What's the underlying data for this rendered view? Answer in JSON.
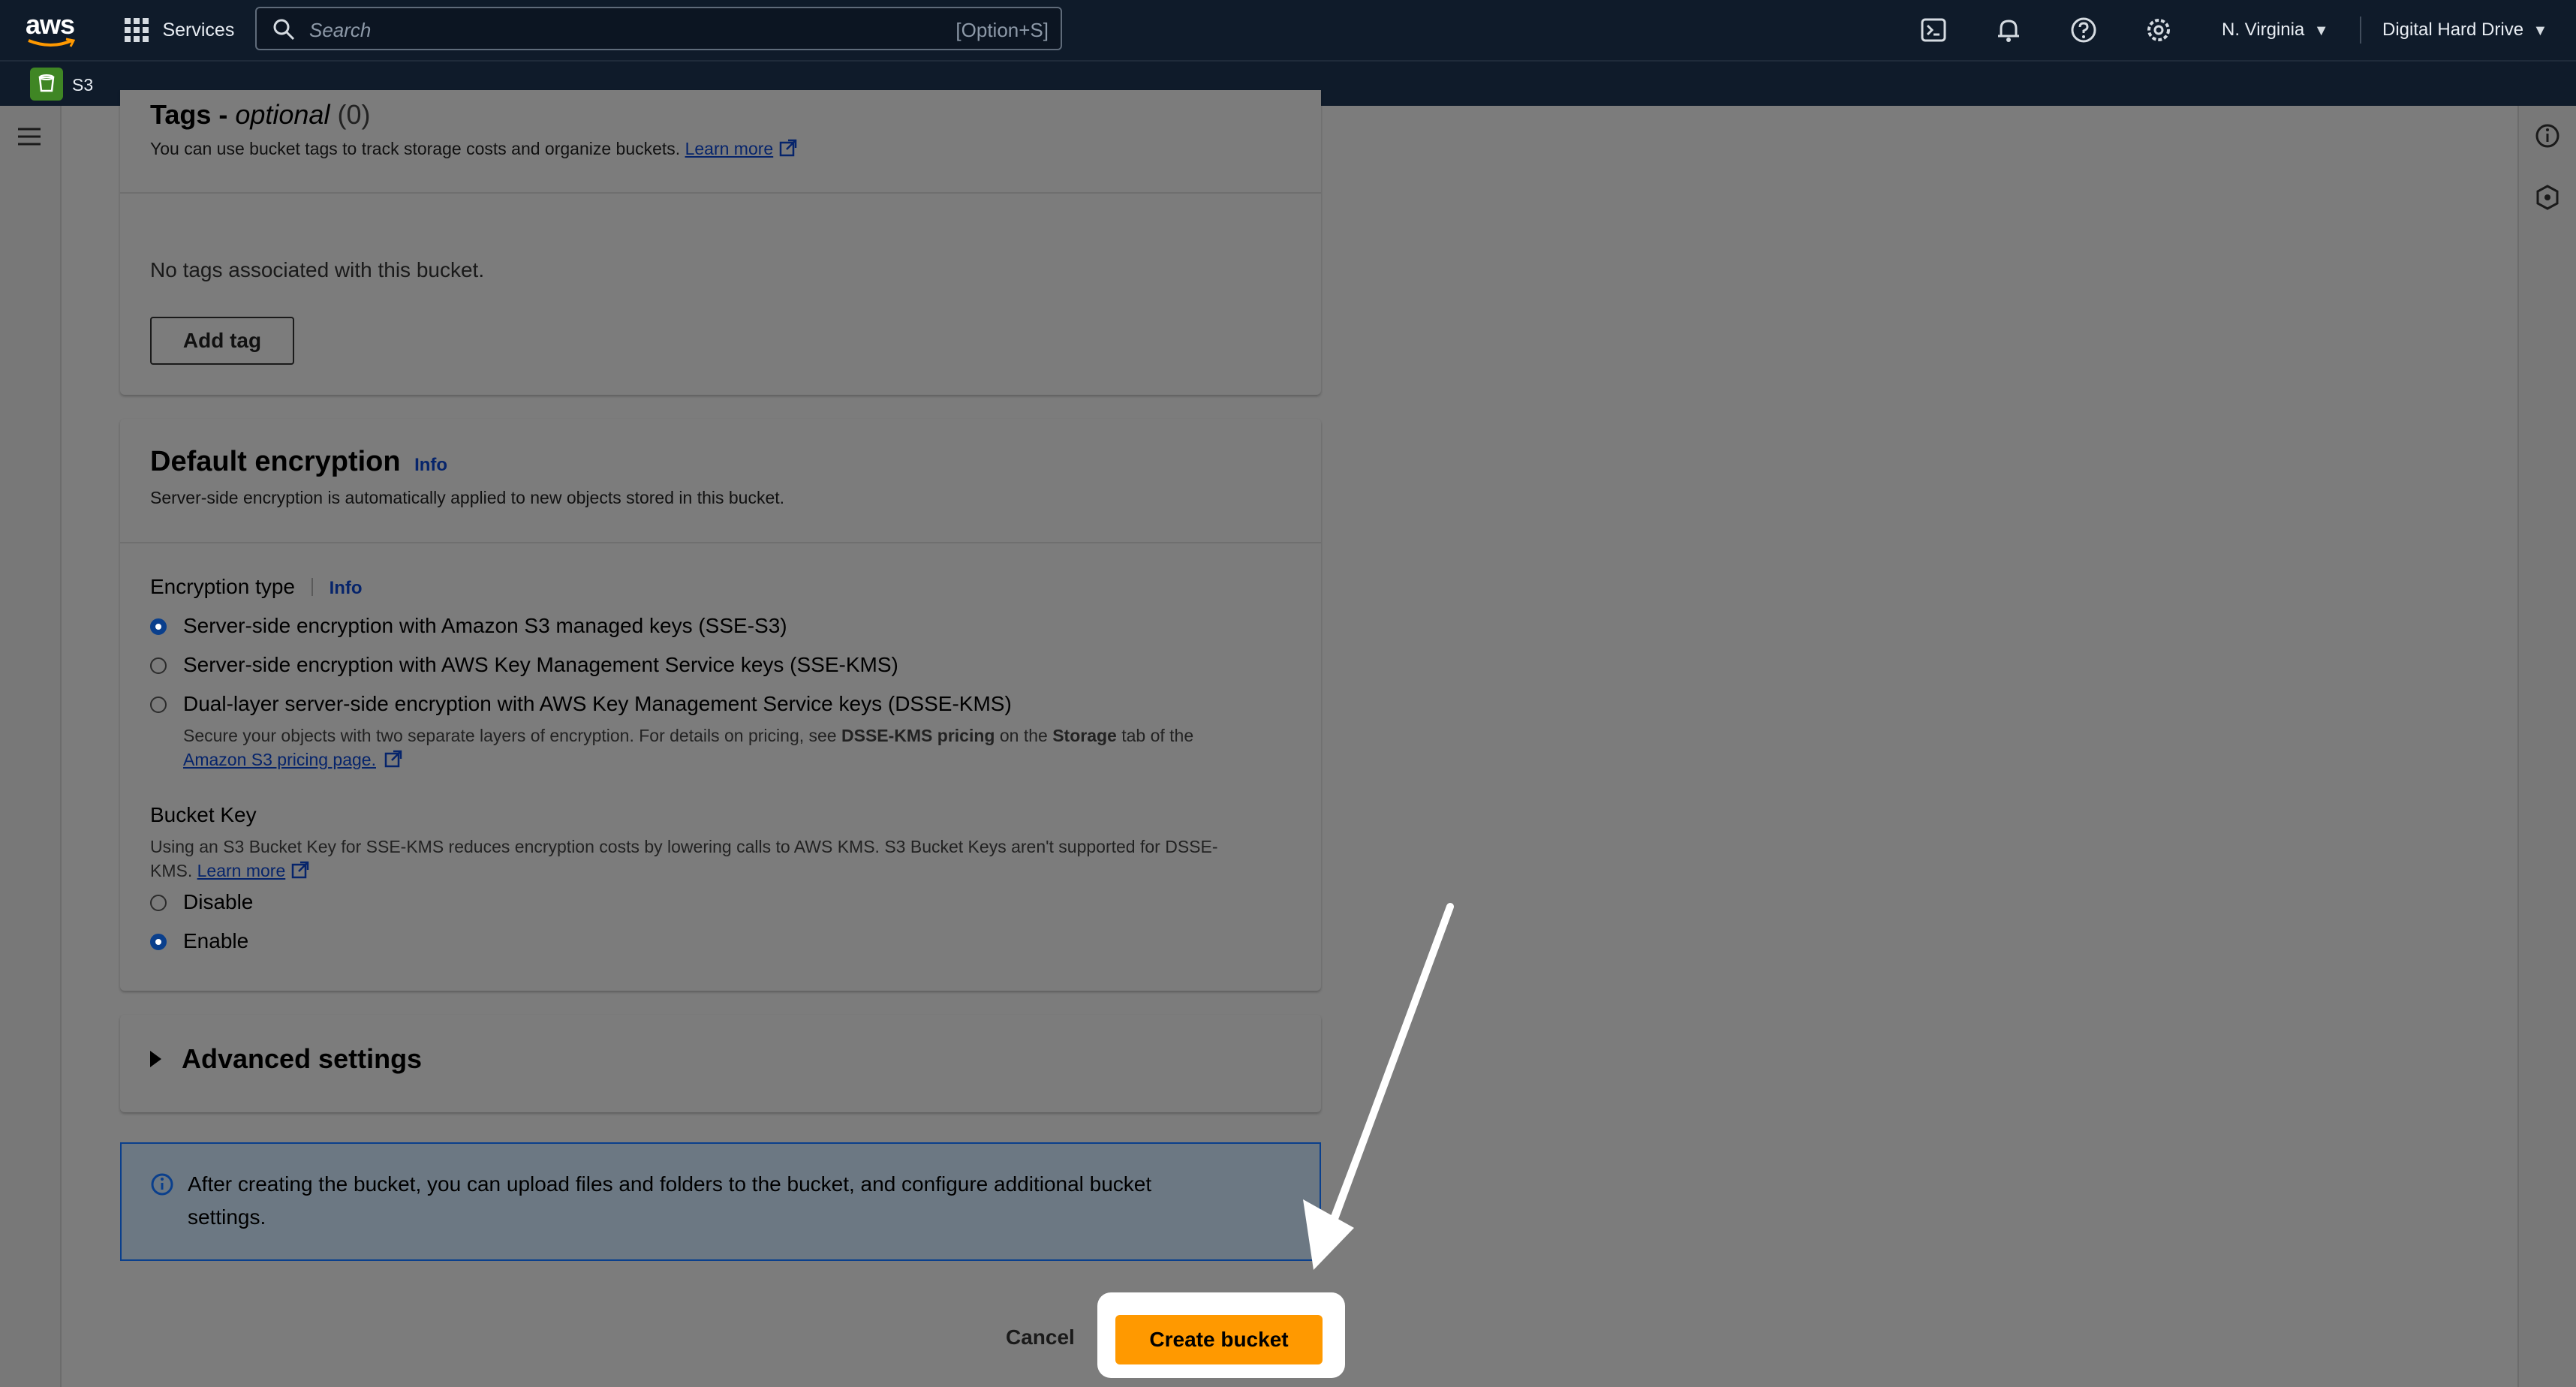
{
  "nav": {
    "logo": "aws",
    "services": "Services",
    "search_placeholder": "Search",
    "search_shortcut": "[Option+S]",
    "region": "N. Virginia",
    "account": "Digital Hard Drive",
    "service_crumb": "S3",
    "icons": [
      "grid-icon",
      "search-icon",
      "cloudshell-icon",
      "bell-icon",
      "help-icon",
      "gear-icon"
    ]
  },
  "tags": {
    "title_prefix": "Tags - ",
    "title_optional": "optional",
    "title_count": "(0)",
    "desc": "You can use bucket tags to track storage costs and organize buckets.",
    "learn_more": "Learn more",
    "empty": "No tags associated with this bucket.",
    "add_tag": "Add tag"
  },
  "encryption": {
    "title": "Default encryption",
    "info": "Info",
    "desc": "Server-side encryption is automatically applied to new objects stored in this bucket.",
    "type_label": "Encryption type",
    "type_info": "Info",
    "options": [
      {
        "label": "Server-side encryption with Amazon S3 managed keys (SSE-S3)",
        "selected": true
      },
      {
        "label": "Server-side encryption with AWS Key Management Service keys (SSE-KMS)",
        "selected": false
      },
      {
        "label": "Dual-layer server-side encryption with AWS Key Management Service keys (DSSE-KMS)",
        "selected": false
      }
    ],
    "dsse_desc_a": "Secure your objects with two separate layers of encryption. For details on pricing, see ",
    "dsse_desc_b": "DSSE-KMS pricing",
    "dsse_desc_c": " on the ",
    "dsse_desc_d": "Storage",
    "dsse_desc_e": " tab of the",
    "dsse_link": "Amazon S3 pricing page.",
    "bucket_key_label": "Bucket Key",
    "bucket_key_desc_1": "Using an S3 Bucket Key for SSE-KMS reduces encryption costs by lowering calls to AWS KMS. S3 Bucket Keys aren't supported for DSSE-",
    "bucket_key_desc_2": "KMS.",
    "bucket_key_learn": "Learn more",
    "bucket_key_options": [
      {
        "label": "Disable",
        "selected": false
      },
      {
        "label": "Enable",
        "selected": true
      }
    ]
  },
  "advanced": {
    "title": "Advanced settings"
  },
  "alert": {
    "line1": "After creating the bucket, you can upload files and folders to the bucket, and configure additional bucket",
    "line2": "settings."
  },
  "actions": {
    "cancel": "Cancel",
    "create": "Create bucket"
  },
  "colors": {
    "nav_bg": "#0f1b2a",
    "primary": "#ff9900",
    "link": "#06246b",
    "overlay": "#7c7c7c"
  }
}
